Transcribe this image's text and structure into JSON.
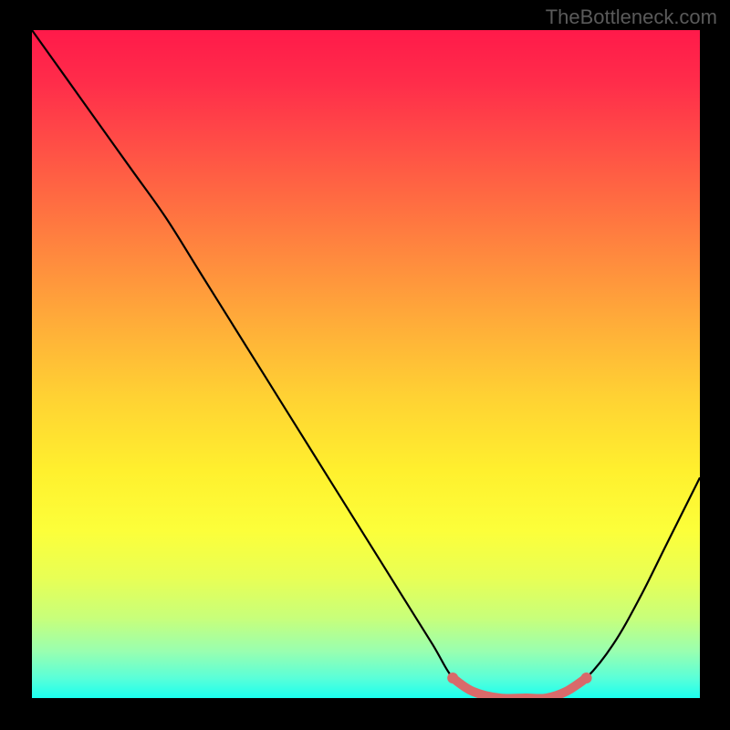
{
  "watermark": "TheBottleneck.com",
  "chart_data": {
    "type": "line",
    "title": "",
    "xlabel": "",
    "ylabel": "",
    "xlim": [
      0,
      100
    ],
    "ylim": [
      0,
      100
    ],
    "series": [
      {
        "name": "bottleneck-curve",
        "x": [
          0,
          5,
          10,
          15,
          20,
          25,
          30,
          35,
          40,
          45,
          50,
          55,
          60,
          63,
          66,
          70,
          74,
          77,
          80,
          83,
          87,
          91,
          95,
          100
        ],
        "values": [
          100,
          93,
          86,
          79,
          72,
          64,
          56,
          48,
          40,
          32,
          24,
          16,
          8,
          3,
          1,
          0,
          0,
          0,
          1,
          3,
          8,
          15,
          23,
          33
        ]
      },
      {
        "name": "highlight-segment",
        "x": [
          63,
          66,
          70,
          74,
          77,
          80,
          83
        ],
        "values": [
          3,
          1,
          0,
          0,
          0,
          1,
          3
        ]
      }
    ],
    "highlight_color": "#d96a6a",
    "curve_color": "#000000",
    "gradient_stops": [
      {
        "pos": 0,
        "color": "#ff1a4a"
      },
      {
        "pos": 25,
        "color": "#ff6a42"
      },
      {
        "pos": 55,
        "color": "#ffd233"
      },
      {
        "pos": 82,
        "color": "#e8ff55"
      },
      {
        "pos": 100,
        "color": "#1bffef"
      }
    ]
  }
}
